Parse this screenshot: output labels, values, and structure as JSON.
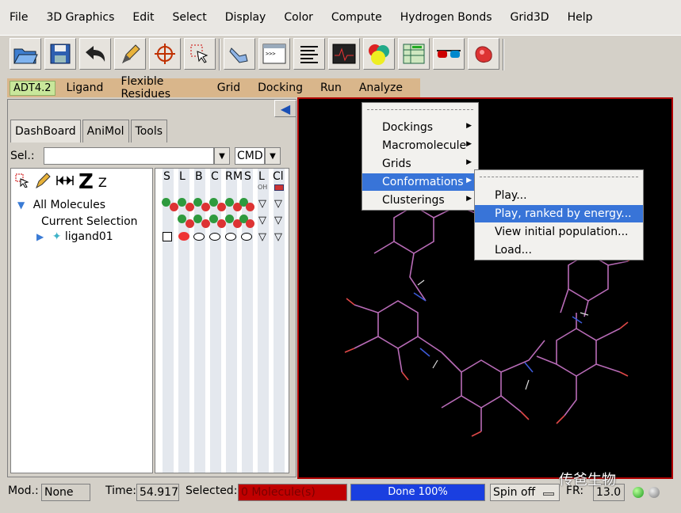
{
  "menubar": [
    "File",
    "3D Graphics",
    "Edit",
    "Select",
    "Display",
    "Color",
    "Compute",
    "Hydrogen Bonds",
    "Grid3D",
    "Help"
  ],
  "toolbar": {
    "icons": [
      "open-folder-icon",
      "save-disk-icon",
      "undo-arrow-icon",
      "pick-pencil-icon",
      "center-target-icon",
      "select-cursor-icon",
      "measure-hand-icon",
      "python-shell-icon",
      "log-lines-icon",
      "oscilloscope-icon",
      "colored-spheres-icon",
      "dashboard-table-icon",
      "stereo-glasses-icon",
      "surface-blob-icon"
    ]
  },
  "adt": {
    "version": "ADT4.2",
    "menus": [
      "Ligand",
      "Flexible Residues",
      "Grid",
      "Docking",
      "Run",
      "Analyze"
    ]
  },
  "left": {
    "tabs": [
      "DashBoard",
      "AniMol",
      "Tools"
    ],
    "sel_label": "Sel.:",
    "sel_value": "",
    "cmd": "CMD",
    "tree": {
      "all": "All Molecules",
      "current": "Current Selection",
      "ligand": "ligand01"
    },
    "columns": [
      "S",
      "L",
      "B",
      "C",
      "R",
      "M",
      "S",
      "L",
      "Cl"
    ],
    "col_oh": "OH"
  },
  "analyze_menu": {
    "items": [
      "Dockings",
      "Macromolecule",
      "Grids",
      "Conformations",
      "Clusterings"
    ],
    "highlighted": "Conformations"
  },
  "conformations_menu": {
    "items": [
      "Play...",
      "Play, ranked by energy...",
      "View initial population...",
      "Load..."
    ],
    "highlighted": "Play, ranked by energy..."
  },
  "status": {
    "mod_label": "Mod.:",
    "mod_value": "None",
    "time_label": "Time:",
    "time_value": "54.917",
    "selected_label": "Selected:",
    "selected_value": "0 Molecule(s)",
    "progress_text": "Done 100%",
    "progress": 1.0,
    "spin": "Spin off",
    "fr_label": "FR:",
    "fr_value": "13.0"
  },
  "watermark": "传爸生物",
  "colors": {
    "viewer_bg": "#000000",
    "viewer_border": "#b00000",
    "adt_bar": "#d9b68b",
    "menu_highlight": "#3874d8",
    "selected_bg": "#c00000",
    "progress_bg": "#1a3fe0"
  }
}
